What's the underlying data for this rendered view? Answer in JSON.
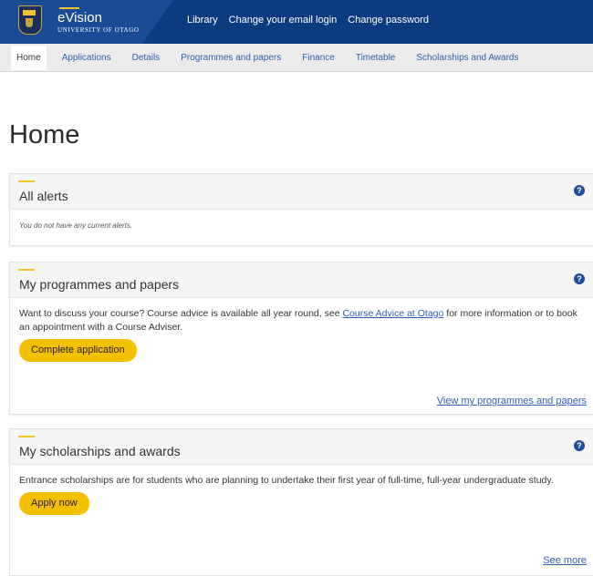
{
  "header": {
    "brand_name": "eVision",
    "brand_sub": "UNIVERSITY OF OTAGO",
    "links": [
      "Library",
      "Change your email login",
      "Change password"
    ]
  },
  "nav": {
    "tabs": [
      "Home",
      "Applications",
      "Details",
      "Programmes and papers",
      "Finance",
      "Timetable",
      "Scholarships and Awards"
    ],
    "active": "Home"
  },
  "page_title": "Home",
  "alerts": {
    "title": "All alerts",
    "message": "You do not have any current alerts."
  },
  "programmes": {
    "title": "My programmes and papers",
    "text_before": "Want to discuss your course? Course advice is available all year round, see ",
    "link_text": "Course Advice at Otago",
    "text_after": " for more information or to book an appointment with a Course Adviser.",
    "button": "Complete application",
    "footer_link": "View my programmes and papers"
  },
  "scholarships": {
    "title": "My scholarships and awards",
    "text": "Entrance scholarships are for students who are planning to undertake their first year of full-time, full-year undergraduate study.",
    "button": "Apply now",
    "footer_link": "See more"
  },
  "help_glyph": "?",
  "colors": {
    "header": "#0d3b80",
    "accent": "#f2c12e",
    "button": "#f5c000",
    "link": "#2d5fb4"
  }
}
